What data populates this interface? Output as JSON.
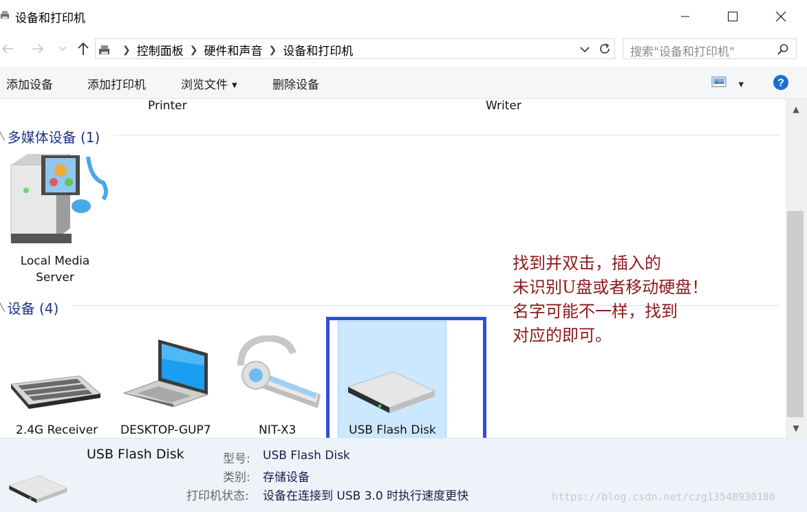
{
  "window": {
    "title": "设备和打印机",
    "icons": {
      "app": "devices-printers-icon",
      "minimize": "minimize-icon",
      "maximize": "maximize-icon",
      "close": "close-icon"
    }
  },
  "address": {
    "crumbs": [
      "控制面板",
      "硬件和声音",
      "设备和打印机"
    ],
    "icons": {
      "back": "back-arrow-icon",
      "forward": "forward-arrow-icon",
      "recent": "chevron-down-icon",
      "up": "up-arrow-icon",
      "refresh": "refresh-icon",
      "dropdown": "chevron-down-icon"
    }
  },
  "search": {
    "placeholder": "搜索\"设备和打印机\"",
    "icon": "search-icon"
  },
  "toolbar": {
    "add_device": "添加设备",
    "add_printer": "添加打印机",
    "browse_files": "浏览文件",
    "remove_device": "删除设备",
    "view_icon": "view-options-icon",
    "help_icon": "help-icon",
    "help_glyph": "?"
  },
  "partial_row": [
    "Printer",
    "Writer"
  ],
  "groups": {
    "multimedia": {
      "label": "多媒体设备 (1)",
      "devices": [
        {
          "line1": "Local Media",
          "line2": "Server",
          "icon": "media-server-icon"
        }
      ]
    },
    "devices": {
      "label": "设备 (4)",
      "devices": [
        {
          "label": "2.4G Receiver",
          "icon": "keyboard-icon"
        },
        {
          "label": "DESKTOP-GUP7",
          "icon": "laptop-icon"
        },
        {
          "label": "NIT-X3",
          "icon": "headset-icon"
        },
        {
          "label": "USB Flash Disk",
          "icon": "usb-drive-icon",
          "selected": true
        }
      ]
    }
  },
  "annotation": {
    "lines": [
      "找到并双击，插入的",
      "未识别U盘或者移动硬盘！",
      "名字可能不一样，找到",
      "对应的即可。"
    ],
    "color": "#8b1a1a",
    "box_color": "#2f4fd1"
  },
  "details": {
    "name": "USB Flash Disk",
    "model_key": "型号:",
    "model_val": "USB Flash Disk",
    "category_key": "类别:",
    "category_val": "存储设备",
    "status_key": "打印机状态:",
    "status_val": "设备在连接到 USB 3.0 时执行速度更快",
    "icon": "usb-drive-icon"
  },
  "watermark": "https://blog.csdn.net/czg13548930186"
}
